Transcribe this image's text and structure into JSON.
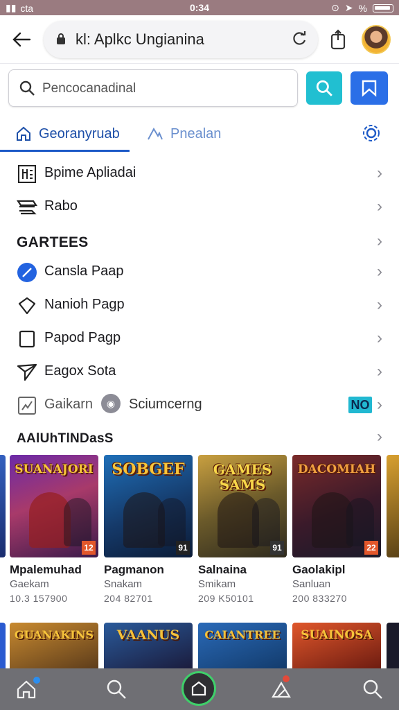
{
  "status_bar": {
    "carrier": "cta",
    "time": "0:34",
    "battery_icon": "battery-icon",
    "signal_text": "%"
  },
  "browser": {
    "url": "kl: Aplkc Ungianina",
    "back_icon": "back-arrow-icon",
    "lock_icon": "lock-icon",
    "reload_icon": "reload-icon",
    "share_icon": "share-icon"
  },
  "search": {
    "placeholder": "Pencocanadinal",
    "search_icon": "search-icon",
    "bookmark_icon": "bookmark-icon"
  },
  "tabs": [
    {
      "label": "Georanyruab",
      "icon": "home-icon",
      "active": true
    },
    {
      "label": "Pnealan",
      "icon": "mountain-icon",
      "active": false
    }
  ],
  "menu": {
    "items_top": [
      {
        "label": "Bpime Apliadai",
        "icon": "apps-icon"
      },
      {
        "label": "Rabo",
        "icon": "stack-icon"
      }
    ],
    "section_games": "GARTEES",
    "items_games": [
      {
        "label": "Cansla Paap",
        "icon": "edit-circle-icon"
      },
      {
        "label": "Nanioh Pagp",
        "icon": "shield-icon"
      },
      {
        "label": "Papod Pagp",
        "icon": "square-icon"
      },
      {
        "label": "Eagox Sota",
        "icon": "send-icon"
      }
    ],
    "extra_row": {
      "label": "Gaikarn",
      "chip_label": "Sciumcerng",
      "badge": "NO"
    },
    "section_apps": "AAlUhTlNDasS"
  },
  "games": [
    {
      "title_art": "SUANAJORI",
      "name": "Mpalemuhad",
      "sub": "Gaekam",
      "meta": "10.3 157900",
      "badge": "12"
    },
    {
      "title_art": "SOBGEF",
      "name": "Pagmanon",
      "sub": "Snakam",
      "meta": "204 82701",
      "badge": "91"
    },
    {
      "title_art": "GAMES SAMS",
      "name": "Salnaina",
      "sub": "Smikam",
      "meta": "209 K50101",
      "badge": "91"
    },
    {
      "title_art": "DACOMIAH",
      "name": "Gaolakipl",
      "sub": "Sanluan",
      "meta": "200 833270",
      "badge": "22"
    }
  ],
  "games_row2": [
    {
      "title_art": "GUANAKINS"
    },
    {
      "title_art": "VAANUS"
    },
    {
      "title_art": "CAIANTREE"
    },
    {
      "title_art": "SUAINOSA"
    }
  ],
  "bottom_nav": [
    {
      "icon": "home-icon"
    },
    {
      "icon": "search-icon"
    },
    {
      "icon": "square-home-icon"
    },
    {
      "icon": "notification-icon"
    },
    {
      "icon": "search-icon"
    }
  ],
  "colors": {
    "accent_blue": "#1d5ac7",
    "cyan": "#21bfd1",
    "bookmark_blue": "#2b6fe7",
    "nav_bg": "#6f6f74"
  }
}
